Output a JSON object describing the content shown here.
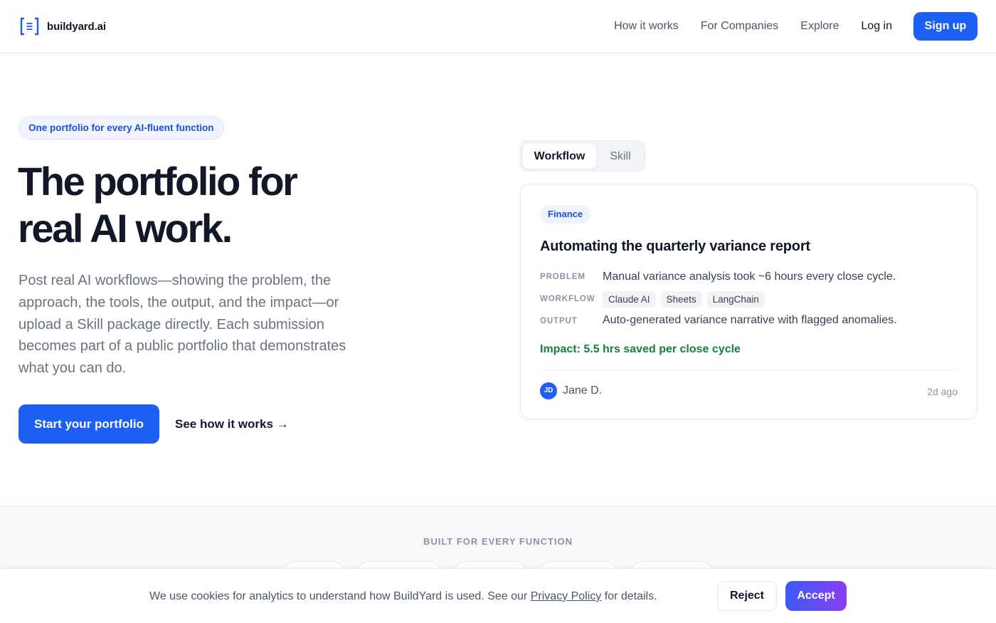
{
  "header": {
    "brand": "buildyard.ai",
    "logo_icon": "bracket-list-icon",
    "brand_color": "#1d5ff5",
    "nav": [
      {
        "label": "How it works"
      },
      {
        "label": "For Companies"
      },
      {
        "label": "Explore"
      }
    ],
    "login_label": "Log in",
    "signup_label": "Sign up"
  },
  "hero": {
    "pill": "One portfolio for every AI-fluent function",
    "title_line1": "The portfolio for",
    "title_line2": "real AI work.",
    "description": "Post real AI workflows—showing the problem, the approach, the tools, the output, and the impact—or upload a Skill package directly. Each submission becomes part of a public portfolio that demonstrates what you can do.",
    "primary_cta": "Start your portfolio",
    "secondary_cta": "See how it works →"
  },
  "toggle": {
    "options": [
      "Workflow",
      "Skill"
    ],
    "selected": "Workflow"
  },
  "card": {
    "tag": "Finance",
    "title": "Automating the quarterly variance report",
    "problem_label": "PROBLEM",
    "problem": "Manual variance analysis took ~6 hours every close cycle.",
    "workflow_label": "WORKFLOW",
    "tools": [
      "Claude AI",
      "Sheets",
      "LangChain"
    ],
    "output_label": "OUTPUT",
    "output": "Auto-generated variance narrative with flagged anomalies.",
    "impact": "Impact: 5.5 hrs saved per close cycle",
    "impact_color": "#15803d",
    "author_initials": "JD",
    "author": "Jane D.",
    "time": "2d ago"
  },
  "functions": {
    "title": "BUILT FOR EVERY FUNCTION"
  },
  "cookie": {
    "text_before": "We use cookies for analytics to understand how BuildYard is used. See our ",
    "link": "Privacy Policy",
    "text_after": " for details.",
    "reject_label": "Reject",
    "accept_label": "Accept"
  }
}
